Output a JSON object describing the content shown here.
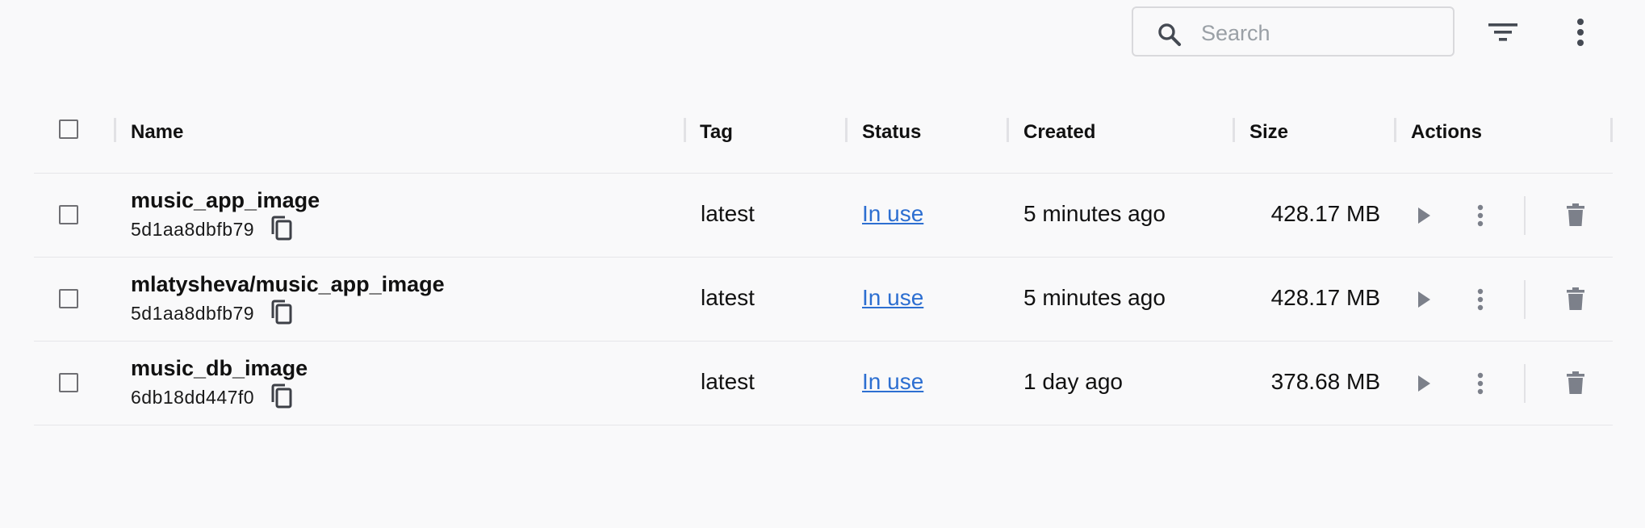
{
  "search": {
    "placeholder": "Search",
    "value": ""
  },
  "toolbar": {
    "filter_icon": "filter-list-icon",
    "more_icon": "more-vert-icon"
  },
  "table": {
    "columns": [
      "Name",
      "Tag",
      "Status",
      "Created",
      "Size",
      "Actions"
    ],
    "rows": [
      {
        "name": "music_app_image",
        "id": "5d1aa8dbfb79",
        "tag": "latest",
        "status": "In use",
        "created": "5 minutes ago",
        "size": "428.17 MB"
      },
      {
        "name": "mlatysheva/music_app_image",
        "id": "5d1aa8dbfb79",
        "tag": "latest",
        "status": "In use",
        "created": "5 minutes ago",
        "size": "428.17 MB"
      },
      {
        "name": "music_db_image",
        "id": "6db18dd447f0",
        "tag": "latest",
        "status": "In use",
        "created": "1 day ago",
        "size": "378.68 MB"
      }
    ]
  },
  "colors": {
    "link": "#2d6fd1",
    "icon_gray": "#7c808a",
    "toolbar_icon": "#454a53",
    "background": "#f9f9fa"
  },
  "icons": {
    "search": "search-icon",
    "copy": "content-copy-icon",
    "run": "play-icon",
    "row_menu": "more-vert-icon",
    "delete": "trash-icon"
  }
}
